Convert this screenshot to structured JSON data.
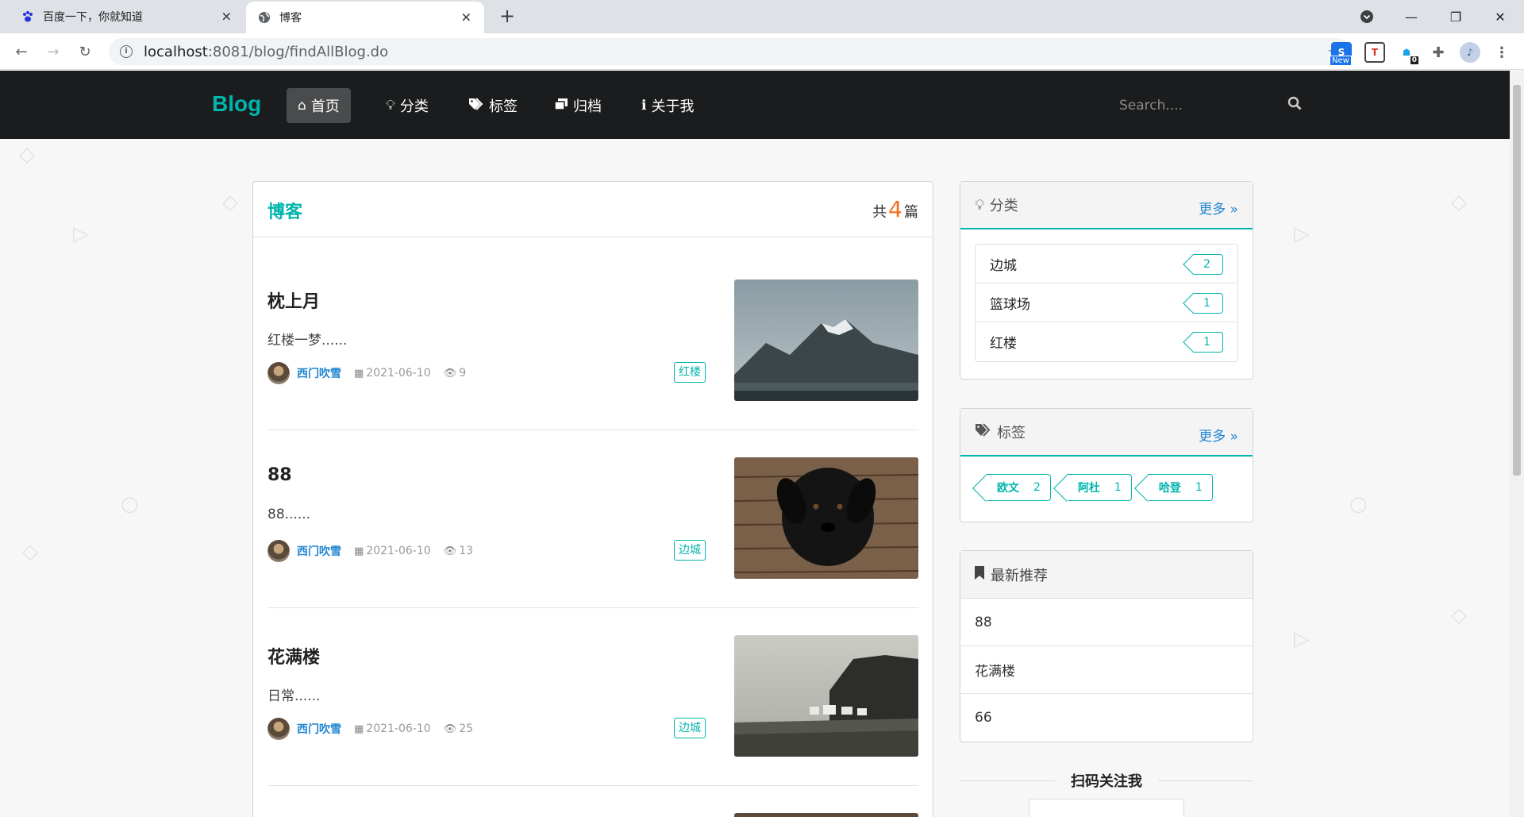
{
  "browser": {
    "tabs": [
      {
        "title": "百度一下，你就知道"
      },
      {
        "title": "博客"
      }
    ],
    "url_host": "localhost",
    "url_rest": ":8081/blog/findAllBlog.do",
    "ext_badge_new": "New",
    "ext_badge_count": "0"
  },
  "nav": {
    "brand": "Blog",
    "items": [
      {
        "label": "首页",
        "icon": "home-icon"
      },
      {
        "label": "分类",
        "icon": "lightbulb-icon"
      },
      {
        "label": "标签",
        "icon": "tags-icon"
      },
      {
        "label": "归档",
        "icon": "clone-icon"
      },
      {
        "label": "关于我",
        "icon": "info-icon"
      }
    ],
    "search_placeholder": "Search...."
  },
  "main": {
    "title": "博客",
    "count_prefix": "共",
    "count": "4",
    "count_suffix": "篇",
    "posts": [
      {
        "title": "枕上月",
        "excerpt": "红楼一梦......",
        "author": "西门吹雪",
        "date": "2021-06-10",
        "views": "9",
        "tag": "红楼",
        "image": "mountain"
      },
      {
        "title": "88",
        "excerpt": "88......",
        "author": "西门吹雪",
        "date": "2021-06-10",
        "views": "13",
        "tag": "边城",
        "image": "dog"
      },
      {
        "title": "花满楼",
        "excerpt": "日常......",
        "author": "西门吹雪",
        "date": "2021-06-10",
        "views": "25",
        "tag": "边城",
        "image": "coast"
      }
    ]
  },
  "sidebar": {
    "categories": {
      "title": "分类",
      "more": "更多",
      "items": [
        {
          "name": "边城",
          "count": "2"
        },
        {
          "name": "篮球场",
          "count": "1"
        },
        {
          "name": "红楼",
          "count": "1"
        }
      ]
    },
    "tags": {
      "title": "标签",
      "more": "更多",
      "items": [
        {
          "name": "欧文",
          "count": "2"
        },
        {
          "name": "阿杜",
          "count": "1"
        },
        {
          "name": "哈登",
          "count": "1"
        }
      ]
    },
    "recommend": {
      "title": "最新推荐",
      "items": [
        "88",
        "花满楼",
        "66"
      ]
    },
    "qr_title": "扫码关注我"
  },
  "colors": {
    "accent": "#00b5ad",
    "link": "#2185d0",
    "count": "#f2711c",
    "navbar": "#1b1c1d"
  }
}
